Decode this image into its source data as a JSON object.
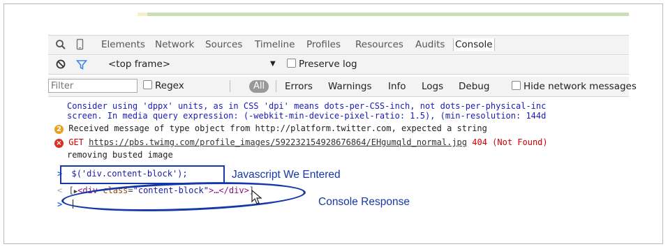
{
  "colors": {
    "annotation": "#1537a8",
    "console_link": "#1a1ab6",
    "error": "#cc0000",
    "warning_badge": "#e8a020",
    "error_badge": "#d93025",
    "progress_yellow": "#f7efc9",
    "progress_green": "#c9dfb8"
  },
  "toolbar": {
    "icons": [
      "search-icon",
      "device-icon"
    ],
    "tabs": [
      "Elements",
      "Network",
      "Sources",
      "Timeline",
      "Profiles",
      "Resources",
      "Audits",
      "Console"
    ],
    "active_tab": "Console"
  },
  "frame_bar": {
    "icons": [
      "clear-icon",
      "filter-icon",
      "dropdown-arrow-icon"
    ],
    "frame_select": "<top frame>",
    "preserve_log": "Preserve log"
  },
  "filter_bar": {
    "filter_placeholder": "Filter",
    "regex": "Regex",
    "levels": [
      "All",
      "Errors",
      "Warnings",
      "Info",
      "Logs",
      "Debug"
    ],
    "hide_network": "Hide network messages"
  },
  "console": {
    "deprecation_line1": "Consider using 'dppx' units, as in CSS 'dpi' means dots-per-CSS-inch, not dots-per-physical-inc",
    "deprecation_line2": "screen. In media query expression: (-webkit-min-device-pixel-ratio: 1.5), (min-resolution: 144d",
    "warning_count": "2",
    "warning_text": "Received message of type object from http://platform.twitter.com, expected a string",
    "error_method": "GET",
    "error_url": "https://pbs.twimg.com/profile_images/592232154928676864/EHgumqld_normal.jpg",
    "error_status": "404 (Not Found)",
    "removing": "removing busted image",
    "input_prompt": ">",
    "input_code": "$('div.content-block');",
    "output_prompt": "<",
    "output_open": "[",
    "output_tag_open": "<div",
    "output_attr_name": "class",
    "output_attr_value": "\"content-block\"",
    "output_mid": ">…</",
    "output_tag_close": "div>",
    "output_close": "]",
    "cursor_prompt": ">"
  },
  "annotations": {
    "input_label": "Javascript We Entered",
    "output_label": "Console Response"
  }
}
